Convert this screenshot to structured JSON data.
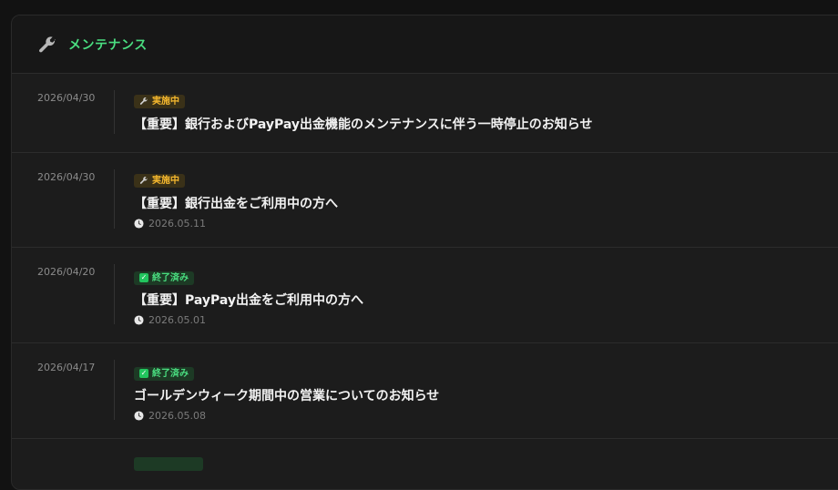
{
  "header": {
    "title": "メンテナンス",
    "icon": "wrench-icon"
  },
  "colors": {
    "accent": "#4ade80",
    "active_badge": "#f5b82e",
    "done_badge": "#4ade80"
  },
  "items": [
    {
      "date": "2026/04/30",
      "status": "実施中",
      "status_type": "active",
      "title": "【重要】銀行およびPayPay出金機能のメンテナンスに伴う一時停止のお知らせ",
      "period": ""
    },
    {
      "date": "2026/04/30",
      "status": "実施中",
      "status_type": "active",
      "title": "【重要】銀行出金をご利用中の方へ",
      "period": "2026.05.11"
    },
    {
      "date": "2026/04/20",
      "status": "終了済み",
      "status_type": "done",
      "title": "【重要】PayPay出金をご利用中の方へ",
      "period": "2026.05.01"
    },
    {
      "date": "2026/04/17",
      "status": "終了済み",
      "status_type": "done",
      "title": "ゴールデンウィーク期間中の営業についてのお知らせ",
      "period": "2026.05.08"
    }
  ]
}
